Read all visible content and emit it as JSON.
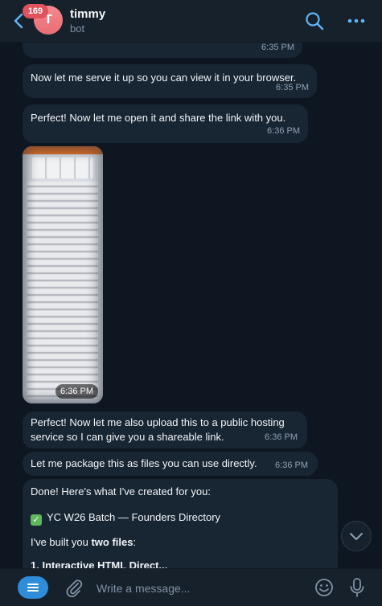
{
  "header": {
    "unread_count": "169",
    "avatar_letter": "T",
    "chat_name": "timmy",
    "chat_status": "bot",
    "accent_color": "#5eb5f7"
  },
  "messages": [
    {
      "time": "6:35 PM"
    },
    {
      "text": "Now let me serve it up so you can view it in your browser.",
      "time": "6:35 PM"
    },
    {
      "text": "Perfect! Now let me open it and share the link with you.",
      "time": "6:36 PM"
    },
    {
      "type": "photo",
      "time": "6:36 PM"
    },
    {
      "text_line1": "Perfect! Now let me also upload this to a public hosting",
      "text_line2": "service so I can give you a shareable link.",
      "time": "6:36 PM"
    },
    {
      "text": "Let me package this as files you can use directly.",
      "time": "6:36 PM"
    },
    {
      "line1": "Done! Here's what I've created for you:",
      "line2_icon": "check-mark-icon",
      "line2": "YC W26 Batch — Founders Directory",
      "line3_start": "I've built you ",
      "line3_bold": "two files",
      "line3_end": ":",
      "line4_partial": "1. Interactive HTML Direct..."
    }
  ],
  "composer": {
    "placeholder": "Write a message..."
  }
}
